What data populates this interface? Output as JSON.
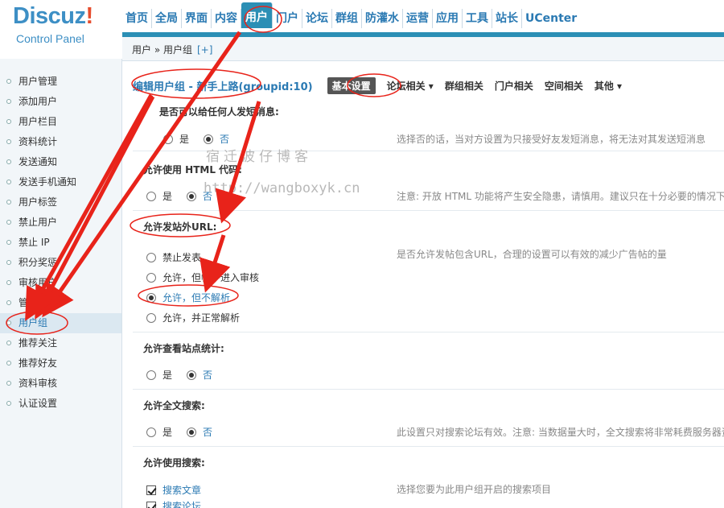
{
  "logo": {
    "brand": "Discuz",
    "bang": "!",
    "subtitle": "Control Panel"
  },
  "topnav": {
    "items": [
      "首页",
      "全局",
      "界面",
      "内容",
      "用户",
      "门户",
      "论坛",
      "群组",
      "防灌水",
      "运营",
      "应用",
      "工具",
      "站长",
      "UCenter"
    ],
    "active": "用户"
  },
  "breadcrumb": {
    "text": "用户 » 用户组",
    "add": "[+]"
  },
  "sidebar": {
    "items": [
      "用户管理",
      "添加用户",
      "用户栏目",
      "资料统计",
      "发送通知",
      "发送手机通知",
      "用户标签",
      "禁止用户",
      "禁止 IP",
      "积分奖惩",
      "审核用户",
      "管理组",
      "用户组",
      "推荐关注",
      "推荐好友",
      "资料审核",
      "认证设置"
    ],
    "active": "用户组"
  },
  "main": {
    "title": "编辑用户组 - 新手上路(groupid:10)",
    "tabs": [
      "基本设置",
      "论坛相关 ▾",
      "群组相关",
      "门户相关",
      "空间相关",
      "其他 ▾"
    ],
    "active_tab": "基本设置",
    "sections": {
      "pm": {
        "label": "是否可以给任何人发短消息:",
        "yes": "是",
        "no": "否",
        "tip": "选择否的话，当对方设置为只接受好友发短消息，将无法对其发送短消息"
      },
      "html": {
        "label": "允许使用 HTML 代码:",
        "yes": "是",
        "no": "否",
        "tip": "注意: 开放 HTML 功能将产生安全隐患，请慎用。建议只在十分必要的情况下"
      },
      "url": {
        "label": "允许发站外URL:",
        "options": [
          "禁止发表",
          "允许，但帖子进入审核",
          "允许，但不解析",
          "允许，并正常解析"
        ],
        "selected_index": 2,
        "tip": "是否允许发帖包含URL，合理的设置可以有效的减少广告帖的量"
      },
      "stats": {
        "label": "允许查看站点统计:",
        "yes": "是",
        "no": "否"
      },
      "fulltext": {
        "label": "允许全文搜索:",
        "yes": "是",
        "no": "否",
        "tip": "此设置只对搜索论坛有效。注意: 当数据量大时，全文搜索将非常耗费服务器资"
      },
      "search": {
        "label": "允许使用搜索:",
        "options": [
          "搜索文章",
          "搜索论坛"
        ],
        "tip": "选择您要为此用户组开启的搜索项目"
      }
    }
  },
  "watermark": {
    "line1": "宿迁波仔博客",
    "line2": "http://wangboxyk.cn"
  },
  "colors": {
    "accent": "#2b8fb5",
    "link": "#2b7ab3",
    "annotation": "#e8231a"
  }
}
